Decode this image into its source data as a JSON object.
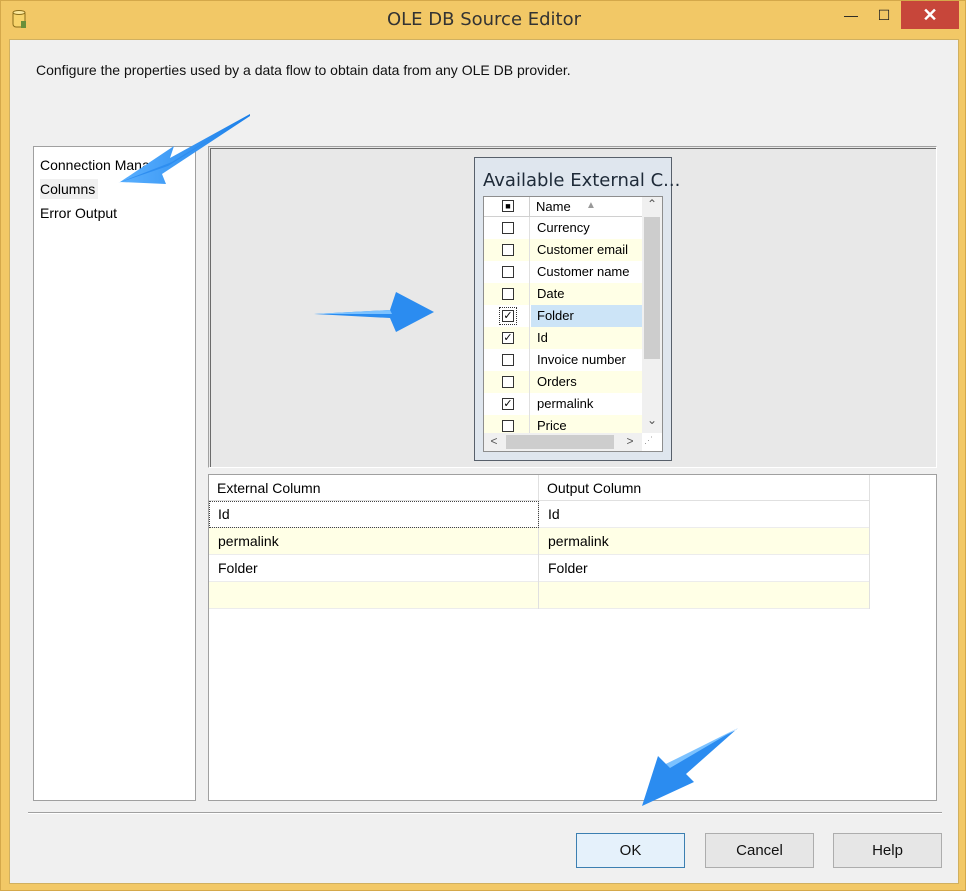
{
  "window": {
    "title": "OLE DB Source Editor",
    "minimize_glyph": "—",
    "maximize_glyph": "☐",
    "close_glyph": "✕"
  },
  "description": "Configure the properties used by a data flow to obtain data from any OLE DB provider.",
  "nav": {
    "items": [
      {
        "label": "Connection Manager",
        "selected": false
      },
      {
        "label": "Columns",
        "selected": true
      },
      {
        "label": "Error Output",
        "selected": false
      }
    ]
  },
  "available_columns": {
    "title": "Available External C...",
    "header_label": "Name",
    "header_check_glyph": "■",
    "sort_glyph": "▲",
    "rows": [
      {
        "name": "Currency",
        "checked": false
      },
      {
        "name": "Customer email",
        "checked": false
      },
      {
        "name": "Customer name",
        "checked": false
      },
      {
        "name": "Date",
        "checked": false
      },
      {
        "name": "Folder",
        "checked": true,
        "selected": true
      },
      {
        "name": "Id",
        "checked": true
      },
      {
        "name": "Invoice number",
        "checked": false
      },
      {
        "name": "Orders",
        "checked": false
      },
      {
        "name": "permalink",
        "checked": true
      },
      {
        "name": "Price",
        "checked": false
      }
    ],
    "check_glyph": "✓",
    "scroll_up_glyph": "⌃",
    "scroll_down_glyph": "⌄",
    "scroll_left_glyph": "<",
    "scroll_right_glyph": ">"
  },
  "mapping_grid": {
    "headers": [
      "External Column",
      "Output Column"
    ],
    "rows": [
      {
        "external": "Id",
        "output": "Id"
      },
      {
        "external": "permalink",
        "output": "permalink"
      },
      {
        "external": "Folder",
        "output": "Folder"
      },
      {
        "external": "",
        "output": ""
      }
    ]
  },
  "buttons": {
    "ok": "OK",
    "cancel": "Cancel",
    "help": "Help"
  },
  "colors": {
    "title_bar": "#f2c866",
    "close_button": "#c7463a",
    "annotation_arrow": "#1e90ff",
    "alt_row": "#ffffe6",
    "selected_row": "#cce4f7"
  }
}
